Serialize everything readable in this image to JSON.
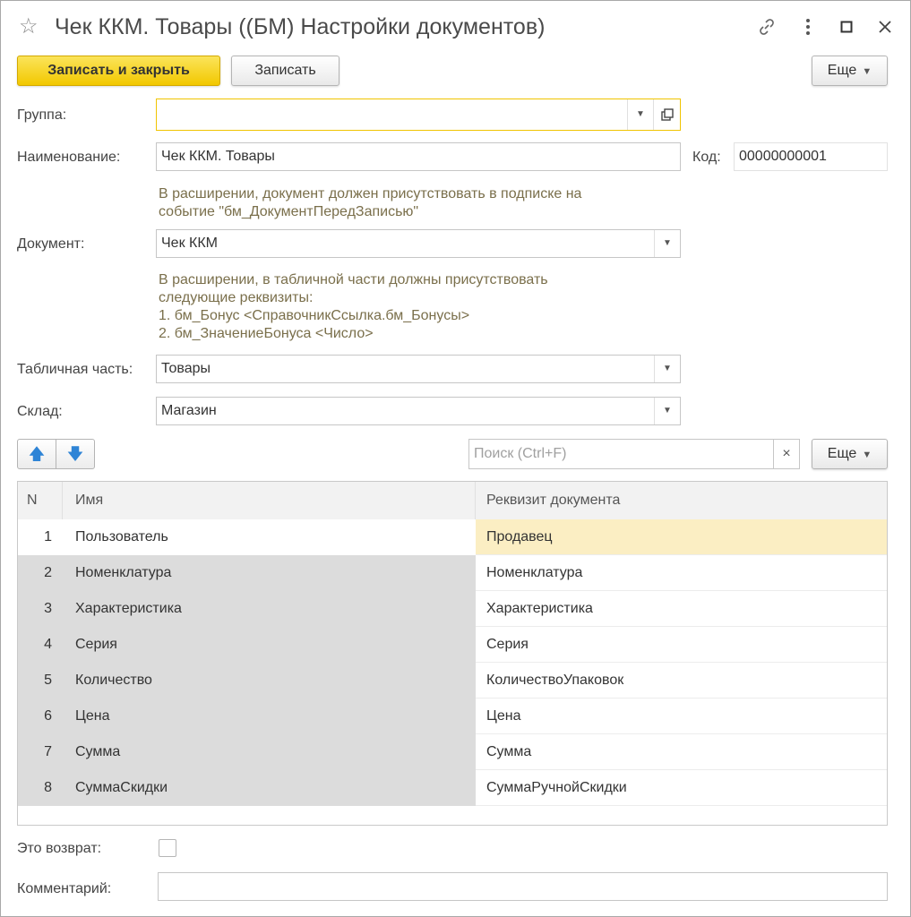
{
  "window": {
    "title": "Чек ККМ. Товары ((БМ) Настройки документов)",
    "icons": {
      "favorite": "star-icon",
      "link": "link-icon",
      "more": "more-vertical-icon",
      "maximize": "maximize-icon",
      "close": "close-icon"
    }
  },
  "toolbar": {
    "save_close_label": "Записать и закрыть",
    "save_label": "Записать",
    "more_label": "Еще"
  },
  "form": {
    "group_label": "Группа:",
    "group_value": "",
    "name_label": "Наименование:",
    "name_value": "Чек ККМ. Товары",
    "code_label": "Код:",
    "code_value": "00000000001",
    "hint1_line1": "В расширении, документ должен присутствовать в подписке на",
    "hint1_line2": "событие \"бм_ДокументПередЗаписью\"",
    "document_label": "Документ:",
    "document_value": "Чек ККМ",
    "hint2_line1": "В расширении, в табличной части должны присутствовать",
    "hint2_line2": "следующие реквизиты:",
    "hint2_line3": "1. бм_Бонус <СправочникСсылка.бм_Бонусы>",
    "hint2_line4": "2. бм_ЗначениеБонуса <Число>",
    "tabular_label": "Табличная часть:",
    "tabular_value": "Товары",
    "warehouse_label": "Склад:",
    "warehouse_value": "Магазин",
    "is_return_label": "Это возврат:",
    "is_return_checked": false,
    "comment_label": "Комментарий:",
    "comment_value": ""
  },
  "table_toolbar": {
    "search_placeholder": "Поиск (Ctrl+F)",
    "more_label": "Еще",
    "clear_symbol": "×"
  },
  "table": {
    "columns": [
      "N",
      "Имя",
      "Реквизит документа"
    ],
    "rows": [
      {
        "n": "1",
        "name": "Пользователь",
        "attr": "Продавец"
      },
      {
        "n": "2",
        "name": "Номенклатура",
        "attr": "Номенклатура"
      },
      {
        "n": "3",
        "name": "Характеристика",
        "attr": "Характеристика"
      },
      {
        "n": "4",
        "name": "Серия",
        "attr": "Серия"
      },
      {
        "n": "5",
        "name": "Количество",
        "attr": "КоличествоУпаковок"
      },
      {
        "n": "6",
        "name": "Цена",
        "attr": "Цена"
      },
      {
        "n": "7",
        "name": "Сумма",
        "attr": "Сумма"
      },
      {
        "n": "8",
        "name": "СуммаСкидки",
        "attr": "СуммаРучнойСкидки"
      }
    ]
  }
}
